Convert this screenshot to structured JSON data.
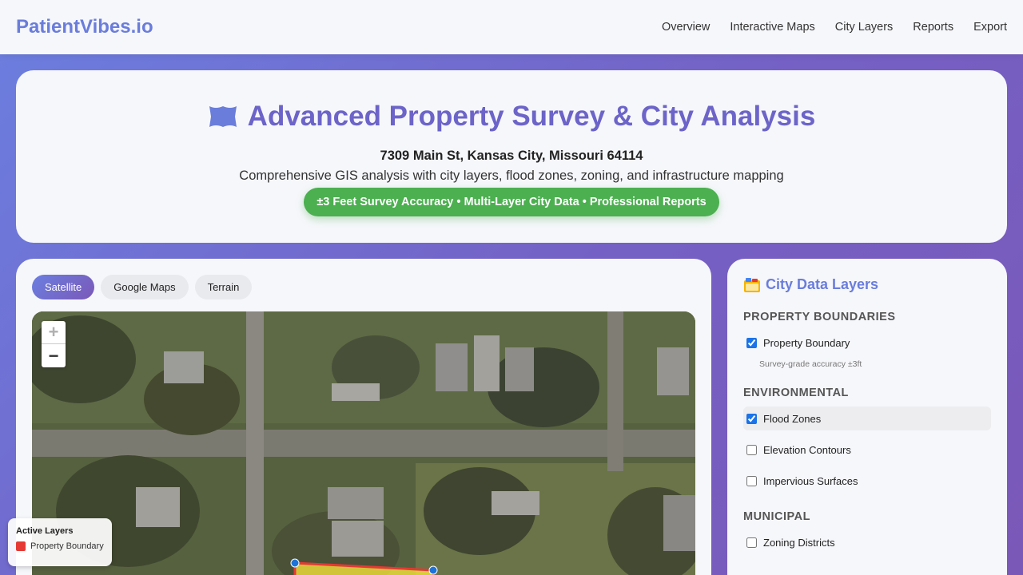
{
  "brand": "PatientVibes.io",
  "nav": [
    "Overview",
    "Interactive Maps",
    "City Layers",
    "Reports",
    "Export"
  ],
  "hero": {
    "title": "Advanced Property Survey & City Analysis",
    "address": "7309 Main St, Kansas City, Missouri 64114",
    "subtitle": "Comprehensive GIS analysis with city layers, flood zones, zoning, and infrastructure mapping",
    "badge": "±3 Feet Survey Accuracy • Multi-Layer City Data • Professional Reports"
  },
  "map": {
    "tabs": [
      "Satellite",
      "Google Maps",
      "Terrain"
    ],
    "active_tab": "Satellite",
    "zoom_in": "+",
    "zoom_out": "−"
  },
  "legend": {
    "title": "Active Layers",
    "items": [
      {
        "label": "Property Boundary",
        "color": "#e53935"
      }
    ]
  },
  "layers": {
    "title": "City Data Layers",
    "sections": [
      {
        "title": "PROPERTY BOUNDARIES",
        "items": [
          {
            "label": "Property Boundary",
            "checked": true,
            "note": "Survey-grade accuracy ±3ft"
          }
        ]
      },
      {
        "title": "ENVIRONMENTAL",
        "items": [
          {
            "label": "Flood Zones",
            "checked": true
          },
          {
            "label": "Elevation Contours",
            "checked": false
          },
          {
            "label": "Impervious Surfaces",
            "checked": false
          }
        ]
      },
      {
        "title": "MUNICIPAL",
        "items": [
          {
            "label": "Zoning Districts",
            "checked": false
          }
        ]
      }
    ]
  },
  "colors": {
    "accent": "#6a7ddb",
    "badge": "#4caf50",
    "boundary": "#e53935"
  }
}
